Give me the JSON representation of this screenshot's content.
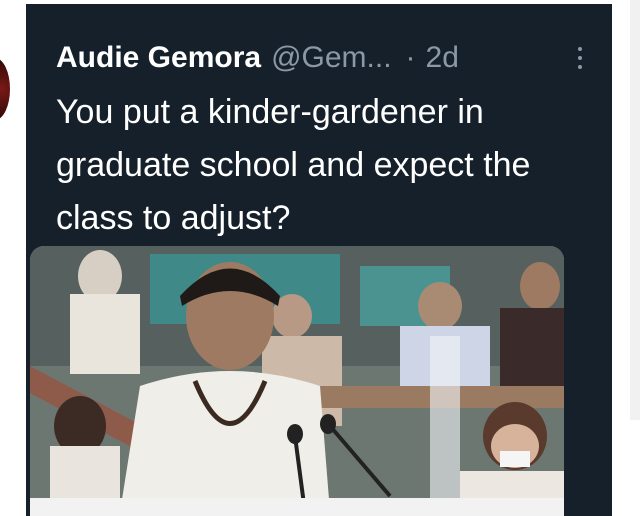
{
  "tweet": {
    "author_name": "Audie Gemora",
    "handle": "@Gem...",
    "separator": "·",
    "time": "2d",
    "text": "You put a kinder-gardener in graduate school and expect the class to adjust?",
    "more_icon": "vertical-ellipsis-icon"
  },
  "media": {
    "description_icon": "photo"
  },
  "colors": {
    "background": "#15202b",
    "text_primary": "#ffffff",
    "text_secondary": "#8b98a5"
  }
}
